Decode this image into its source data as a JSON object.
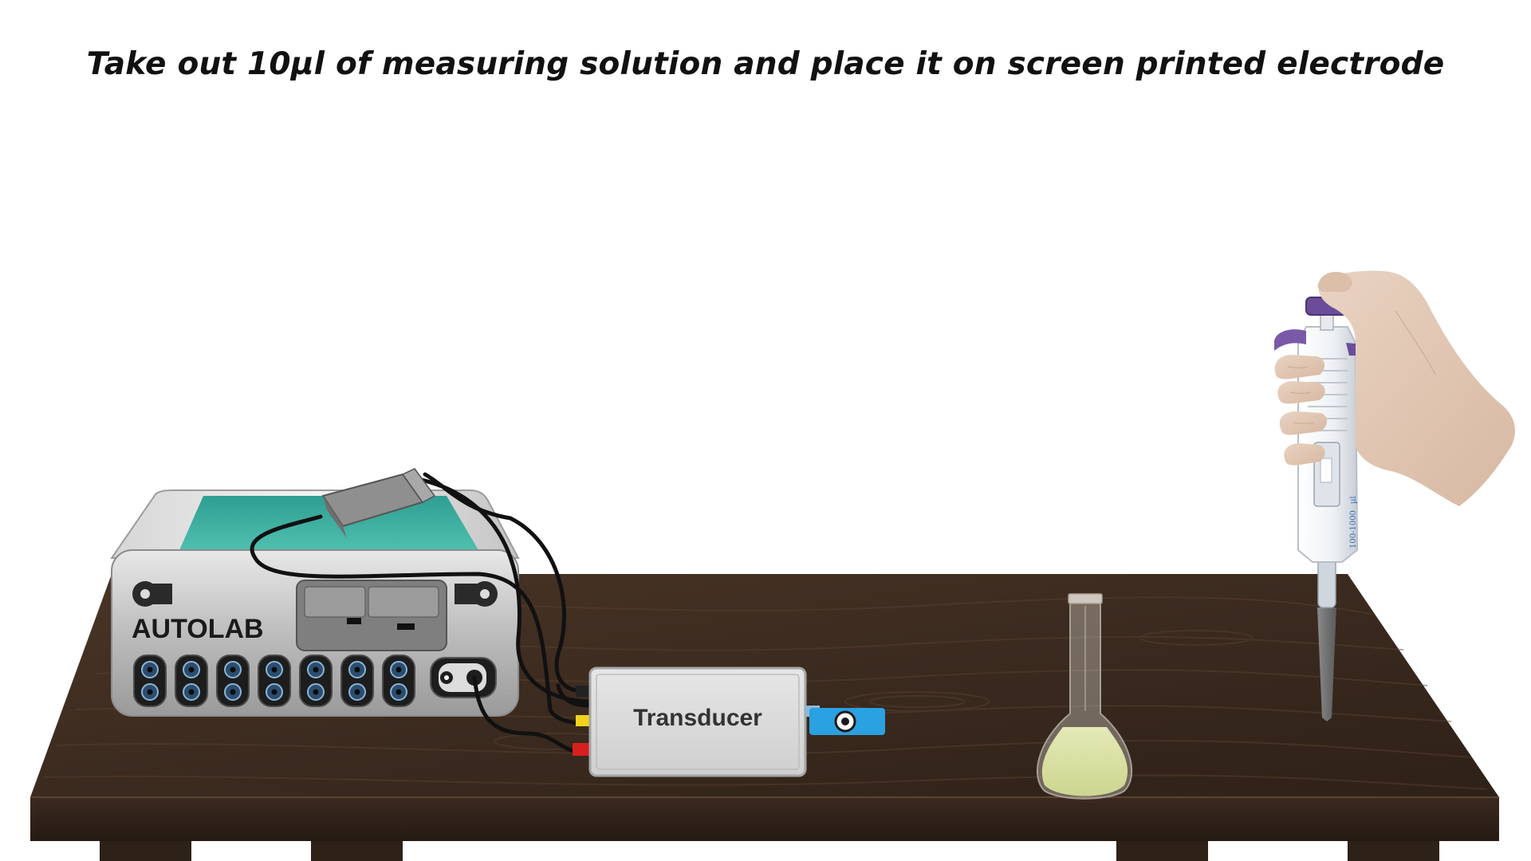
{
  "instruction": {
    "text": "Take out 10µl of measuring solution and place it on screen printed electrode"
  },
  "equipment": {
    "potentiostat_label": "AUTOLAB",
    "transducer_label": "Transducer",
    "pipette_volume_label": "100-1000",
    "pipette_unit_label": "µl"
  },
  "colors": {
    "table_top": "#3b2a1f",
    "table_front": "#2f2118",
    "instrument_body": "#c9c9c9",
    "instrument_screen": "#3aa99c",
    "flask_liquid": "#d9e0a3",
    "usb_connector": "#2aa1e0",
    "pipette_button": "#6b4c9a",
    "hand_skin": "#e2c7b3"
  }
}
